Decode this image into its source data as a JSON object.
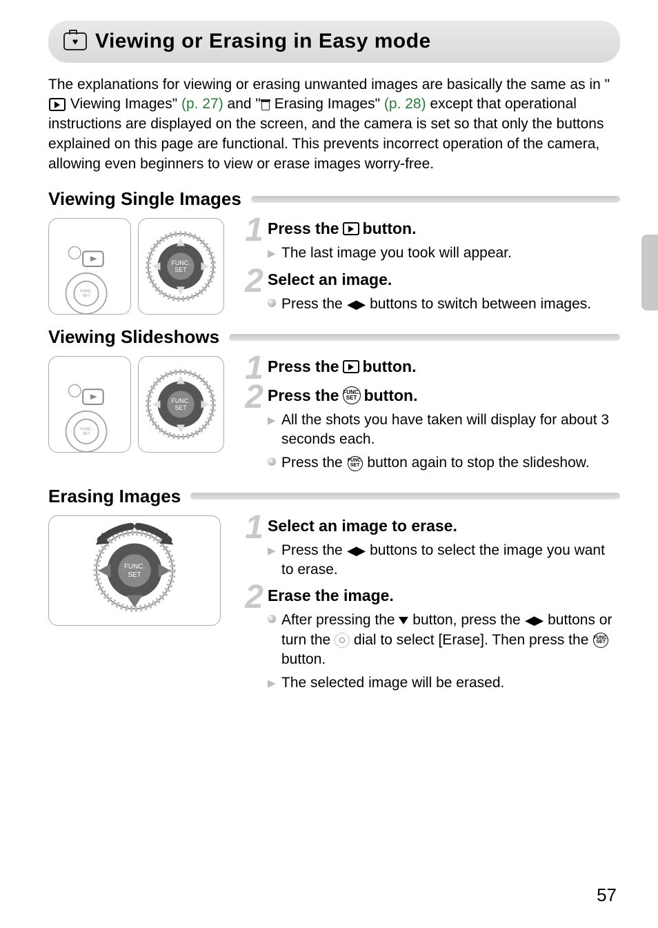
{
  "title": "Viewing or Erasing in Easy mode",
  "intro": {
    "t1": "The explanations for viewing or erasing unwanted images are basically the same as in \"",
    "viewing": " Viewing Images\" ",
    "ref1": "(p. 27)",
    "t2": " and \"",
    "erasing": " Erasing Images\" ",
    "ref2": "(p. 28)",
    "t3": " except that operational instructions are displayed on the screen, and the camera is set so that only the buttons explained on this page are functional. This prevents incorrect operation of the camera, allowing even beginners to view or erase images worry-free."
  },
  "sections": {
    "single": {
      "title": "Viewing Single Images",
      "step1": {
        "pre": "Press the ",
        "post": " button.",
        "b1": "The last image you took will appear."
      },
      "step2": {
        "title": "Select an image.",
        "b1_pre": "Press the ",
        "b1_post": " buttons to switch between images."
      }
    },
    "slide": {
      "title": "Viewing Slideshows",
      "step1": {
        "pre": "Press the ",
        "post": " button."
      },
      "step2": {
        "pre": "Press the ",
        "post": " button.",
        "b1": "All the shots you have taken will display for about 3 seconds each.",
        "b2_pre": "Press the ",
        "b2_post": " button again to stop the slideshow."
      }
    },
    "erase": {
      "title": "Erasing Images",
      "step1": {
        "title": "Select an image to erase.",
        "b1_pre": "Press the ",
        "b1_post": " buttons to select the image you want to erase."
      },
      "step2": {
        "title": "Erase the image.",
        "b1_a": "After pressing the ",
        "b1_b": " button, press the ",
        "b1_c": " buttons or turn the ",
        "b1_d": " dial to select [Erase]. Then press the ",
        "b1_e": " button.",
        "b2": "The selected image will be erased."
      }
    }
  },
  "icons": {
    "func_top": "FUNC.",
    "func_bot": "SET"
  },
  "page_number": "57"
}
